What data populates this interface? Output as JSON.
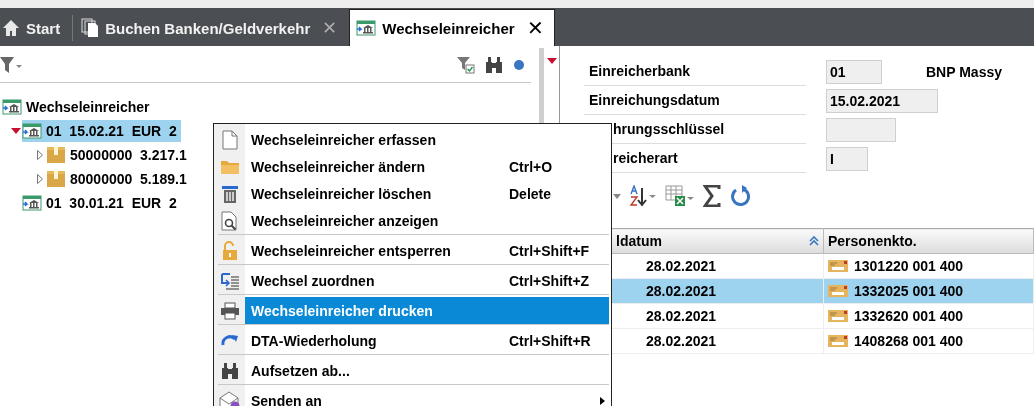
{
  "tabs": [
    {
      "label": "Start",
      "kind": "home",
      "selected": false
    },
    {
      "label": "Buchen Banken/Geldverkehr",
      "kind": "documents",
      "selected": false,
      "close": "✕"
    },
    {
      "label": "Wechseleinreicher",
      "kind": "bank",
      "selected": true,
      "close": "✕"
    }
  ],
  "tree": {
    "label": "Wechseleinreicher",
    "children": [
      {
        "label": "01  15.02.21  EUR  2",
        "selected": true,
        "expanded": true,
        "children": [
          {
            "label": "50000000  3.217.1",
            "selected": false,
            "expanded": false
          },
          {
            "label": "80000000  5.189.1",
            "selected": false,
            "expanded": false
          }
        ]
      },
      {
        "label": "01  30.01.21  EUR  2",
        "selected": false
      }
    ]
  },
  "form": [
    {
      "label": "Einreicherbank",
      "value": "01",
      "note": "BNP Massy"
    },
    {
      "label": "Einreichungsdatum",
      "value": "15.02.2021"
    },
    {
      "label": "hrungsschlüssel"
    },
    {
      "label": "reicherart",
      "value": "I"
    }
  ],
  "table": {
    "columns": [
      {
        "label": "ldatum",
        "sorted": true
      },
      {
        "label": "Personenkto.",
        "sorted": false
      }
    ],
    "rows": [
      {
        "cells": [
          "28.02.2021",
          "1301220 001 400"
        ],
        "selected": false
      },
      {
        "cells": [
          "28.02.2021",
          "1332025 001 400"
        ],
        "selected": true
      },
      {
        "cells": [
          "28.02.2021",
          "1332620 001 400"
        ],
        "selected": false
      },
      {
        "cells": [
          "28.02.2021",
          "1408268 001 400"
        ],
        "selected": false
      }
    ]
  },
  "context_menu": [
    {
      "label": "Wechseleinreicher erfassen",
      "kind": "document",
      "separator_before": false,
      "selected": false
    },
    {
      "label": "Wechseleinreicher ändern",
      "shortcut": "Ctrl+O",
      "kind": "folder",
      "separator_before": false,
      "selected": false
    },
    {
      "label": "Wechseleinreicher löschen",
      "shortcut": "Delete",
      "kind": "trash",
      "separator_before": false,
      "selected": false
    },
    {
      "label": "Wechseleinreicher anzeigen",
      "kind": "preview",
      "separator_before": false,
      "selected": false
    },
    {
      "label": "Wechseleinreicher entsperren",
      "shortcut": "Ctrl+Shift+F",
      "kind": "unlock",
      "separator_before": true,
      "selected": false
    },
    {
      "label": "Wechsel zuordnen",
      "shortcut": "Ctrl+Shift+Z",
      "kind": "assign",
      "separator_before": true,
      "selected": false
    },
    {
      "label": "Wechseleinreicher drucken",
      "kind": "printer",
      "separator_before": true,
      "selected": true
    },
    {
      "label": "DTA-Wiederholung",
      "shortcut": "Ctrl+Shift+R",
      "kind": "redo",
      "separator_before": true,
      "selected": false
    },
    {
      "label": "Aufsetzen ab...",
      "kind": "binoculars",
      "separator_before": true,
      "selected": false
    },
    {
      "label": "Senden an",
      "kind": "envelope",
      "separator_before": true,
      "selected": false,
      "submenu": true
    }
  ]
}
